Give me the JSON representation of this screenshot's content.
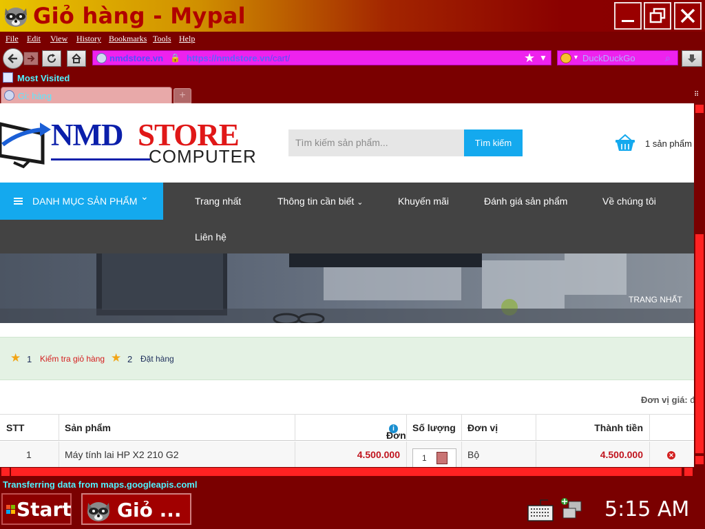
{
  "window": {
    "title": "Giỏ hàng - Mypal"
  },
  "menu": [
    "File",
    "Edit",
    "View",
    "History",
    "Bookmarks",
    "Tools",
    "Help"
  ],
  "navbar": {
    "site_identity": "nmdstore.vn",
    "url_host": "https://nmdstore.vn",
    "url_path": "/cart/",
    "search_placeholder": "DuckDuckGo"
  },
  "bookmarks": {
    "most_visited": "Most Visited"
  },
  "tabs": [
    {
      "label": "Gi: hàng"
    }
  ],
  "site": {
    "logo_nmd": "NMD",
    "logo_store": "STORE",
    "logo_computer": "COMPUTER",
    "search_placeholder": "Tìm kiếm sản phẩm...",
    "search_button": "Tìm kiếm",
    "cart_count": "1 sản phẩm",
    "category_button": "DANH MỤC SẢN PHẨM",
    "nav": {
      "home": "Trang nhất",
      "info": "Thông tin cần biết",
      "promo": "Khuyến mãi",
      "reviews": "Đánh giá sản phẩm",
      "about": "Về chúng tôi",
      "contact": "Liên hệ"
    },
    "breadcrumb": "TRANG NHẤT"
  },
  "steps": [
    {
      "num": "1",
      "label": "Kiểm tra giỏ hàng",
      "color": "#d41e1e"
    },
    {
      "num": "2",
      "label": "Đặt hàng",
      "color": "#1c2d5a"
    }
  ],
  "unit_note": {
    "label": "Đơn vị giá:",
    "value": "đ"
  },
  "cart_table": {
    "headers": {
      "stt": "STT",
      "product": "Sản phẩm",
      "unit_price": "Đơn giá",
      "quantity": "Số lượng",
      "unit": "Đơn vị",
      "total": "Thành tiền"
    },
    "rows": [
      {
        "stt": "1",
        "product": "Máy tính lai HP X2 210 G2",
        "unit_price": "4.500.000",
        "quantity": "1",
        "unit": "Bộ",
        "total": "4.500.000"
      }
    ]
  },
  "status": {
    "text": "Transferring data from maps.googleapis.coml"
  },
  "taskbar": {
    "start": "Start",
    "task_label": "Giỏ ...",
    "clock": "5:15 AM"
  },
  "colors": {
    "chrome_bg": "#7a0000",
    "accent_blue": "#14a9ee",
    "price_red": "#c0141e",
    "nav_dark": "#434343",
    "steps_bg": "#e4f2e4"
  }
}
